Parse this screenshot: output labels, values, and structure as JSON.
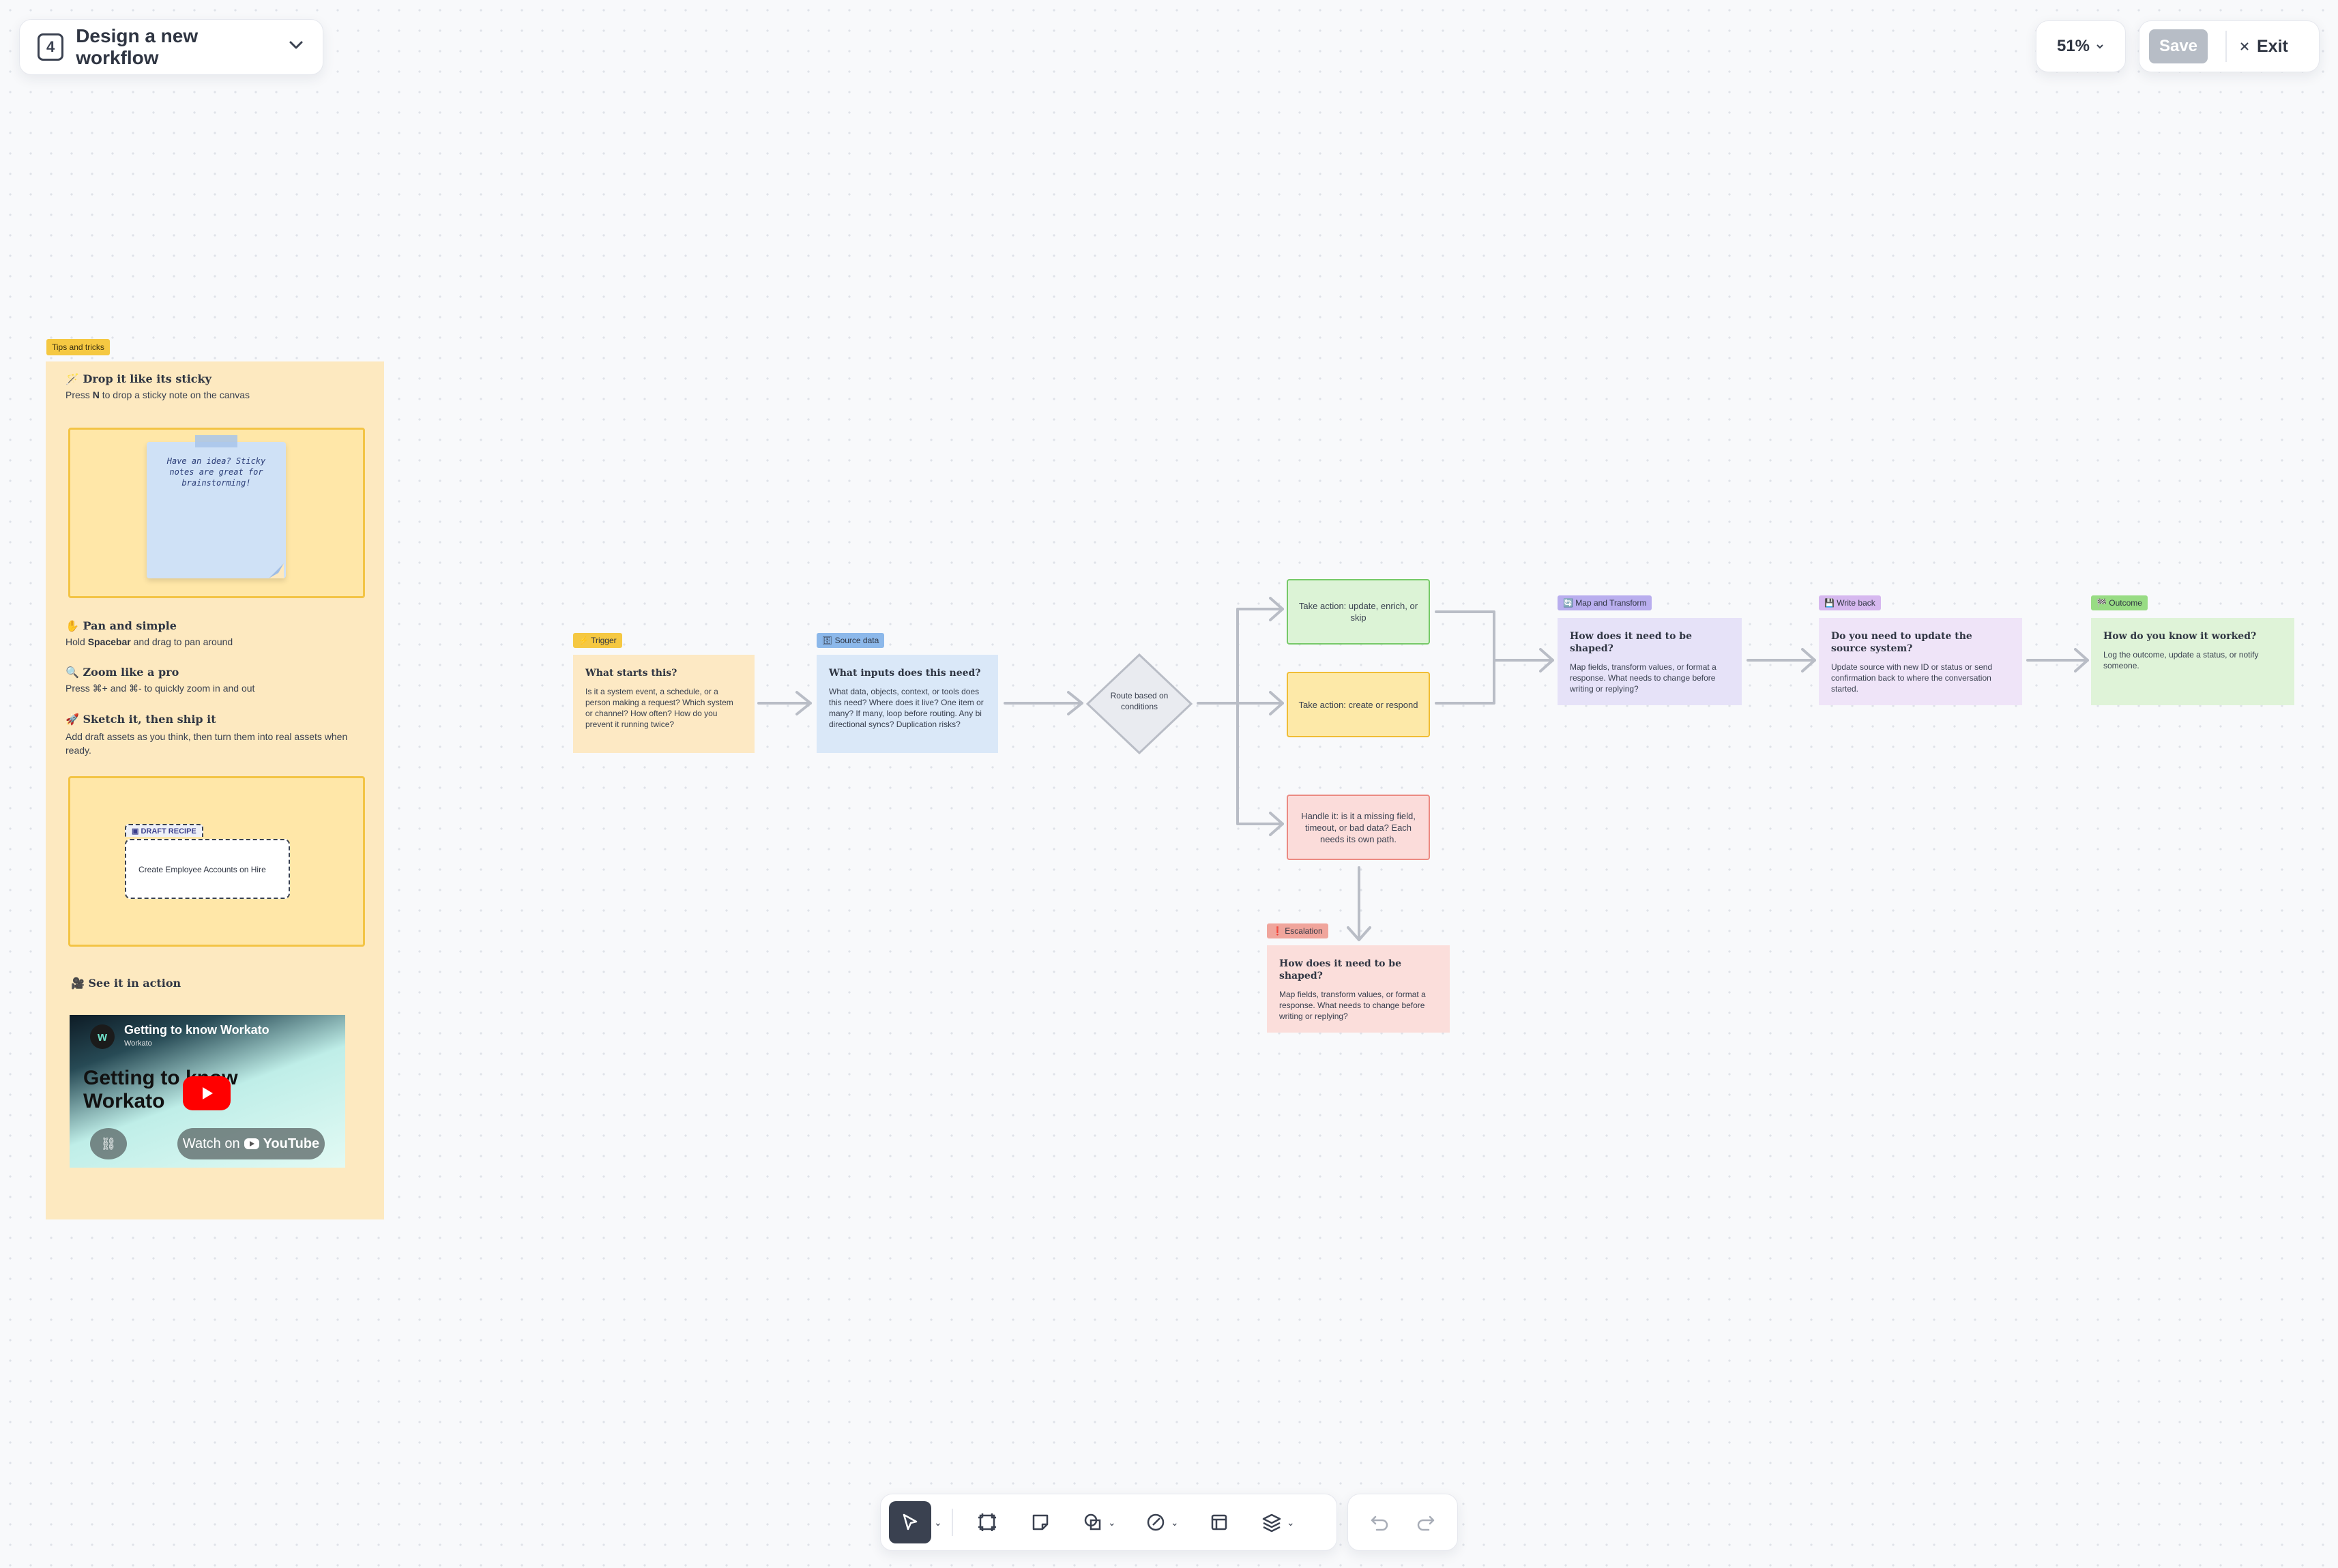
{
  "header": {
    "step_number": "4",
    "title": "Design a new workflow",
    "zoom": "51%",
    "save_label": "Save",
    "exit_label": "Exit"
  },
  "tips": {
    "tag": "Tips and tricks",
    "items": [
      {
        "emoji": "🪄",
        "title": "Drop it like its sticky",
        "desc_pre": "Press ",
        "desc_key": "N",
        "desc_post": " to drop a sticky note on the canvas"
      },
      {
        "emoji": "✋",
        "title": "Pan and simple",
        "desc_pre": "Hold ",
        "desc_key": "Spacebar",
        "desc_post": " and drag to pan around"
      },
      {
        "emoji": "🔍",
        "title": "Zoom like a pro",
        "desc": "Press ⌘+ and ⌘- to quickly zoom in and out"
      },
      {
        "emoji": "🚀",
        "title": "Sketch it, then ship it",
        "desc": "Add draft assets as you think, then turn them into real assets when ready."
      },
      {
        "emoji": "🎥",
        "title": "See it in action"
      }
    ],
    "sticky_text": "Have an idea? Sticky notes are great for brainstorming!",
    "draft_badge": "DRAFT RECIPE",
    "draft_title": "Create Employee Accounts on Hire",
    "video": {
      "title": "Getting to know Workato",
      "channel": "Workato",
      "big_text": "Getting to know Workato",
      "watch_label": "Watch on",
      "youtube_label": "YouTube"
    }
  },
  "flow": {
    "trigger": {
      "tag": "⚡ Trigger",
      "title": "What starts this?",
      "desc": "Is it a system event, a schedule, or a person making a request? Which system or channel? How often? How do you prevent it running twice?"
    },
    "source": {
      "tag": "🗄 Source data",
      "title": "What inputs does this need?",
      "desc": "What data, objects, context, or tools does this need? Where does it live? One item or many? If many, loop before routing. Any bi directional syncs? Duplication risks?"
    },
    "route": "Route based on conditions",
    "action_update": "Take action: update, enrich, or skip",
    "action_create": "Take action: create or respond",
    "action_handle": "Handle it: is it a missing field, timeout, or bad data? Each needs its own path.",
    "escalation": {
      "tag": "❗ Escalation",
      "title": "How does it need to be shaped?",
      "desc": "Map fields, transform values, or format a response. What needs to change before writing or replying?"
    },
    "map": {
      "tag": "🔄 Map and Transform",
      "title": "How does it need to be shaped?",
      "desc": "Map fields, transform values, or format a response. What needs to change before writing or replying?"
    },
    "write": {
      "tag": "💾 Write back",
      "title": "Do you need to update the source system?",
      "desc": "Update source with new ID or status or send confirmation back to where the conversation started."
    },
    "outcome": {
      "tag": "🏁 Outcome",
      "title": "How do you know it worked?",
      "desc": "Log the outcome, update a status, or notify someone."
    }
  },
  "colors": {
    "trigger_bg": "#fde9c4",
    "trigger_tag": "#f5c842",
    "source_bg": "#dae8f8",
    "source_tag": "#8cb8ea",
    "green_bg": "#dcf3d6",
    "green_border": "#76c968",
    "yellow_bg": "#fde9a8",
    "yellow_border": "#f0bd35",
    "red_bg": "#fbdcda",
    "red_border": "#eb8a82",
    "map_bg": "#e6e2f8",
    "map_tag": "#b9aeee",
    "write_bg": "#efe4f8",
    "write_tag": "#d6b8ef",
    "outcome_bg": "#dff3d8",
    "outcome_tag": "#98dc84",
    "escalation_bg": "#fbdedb",
    "escalation_tag": "#f0a59c",
    "connector": "#b9bdc6"
  }
}
